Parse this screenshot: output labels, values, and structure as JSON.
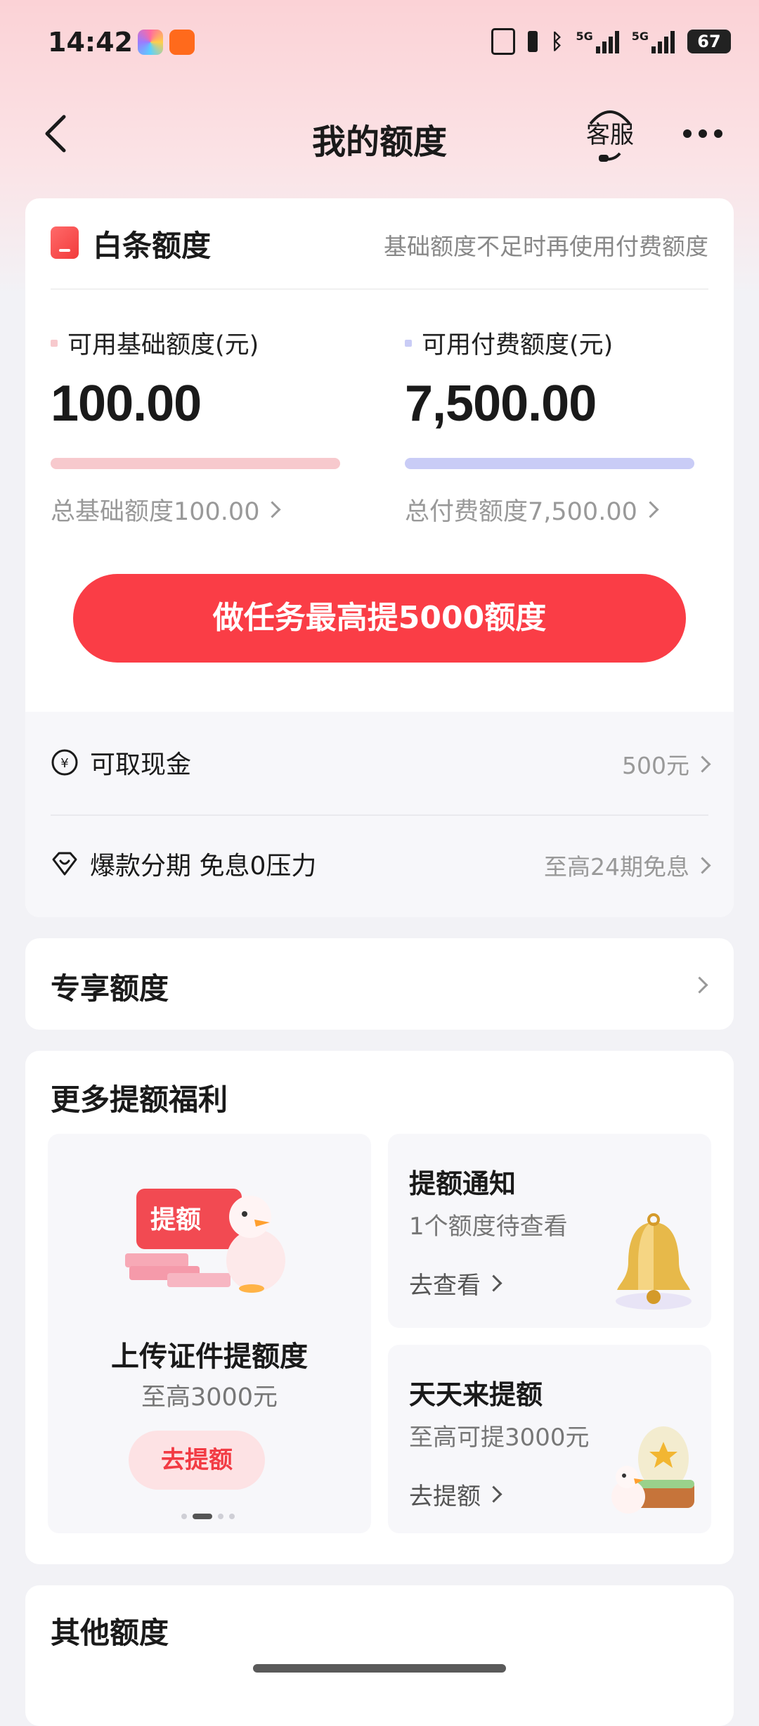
{
  "status_bar": {
    "time": "14:42",
    "net1": "5G",
    "net2": "5G",
    "battery": "67"
  },
  "nav": {
    "title": "我的额度",
    "customer_service": "客服"
  },
  "main_card": {
    "title": "白条额度",
    "hint": "基础额度不足时再使用付费额度",
    "basic": {
      "label": "可用基础额度(元)",
      "value": "100.00",
      "total": "总基础额度100.00",
      "color": "#f7c9cd"
    },
    "paid": {
      "label": "可用付费额度(元)",
      "value": "7,500.00",
      "total": "总付费额度7,500.00",
      "color": "#c9ccf6"
    },
    "cta": "做任务最高提5000额度",
    "rows": [
      {
        "icon": "yen-circle-icon",
        "label": "可取现金",
        "right": "500元"
      },
      {
        "icon": "diamond-heart-icon",
        "label": "爆款分期 免息0压力",
        "right": "至高24期免息"
      }
    ]
  },
  "exclusive": {
    "label": "专享额度"
  },
  "more_benefits": {
    "title": "更多提额福利",
    "big_tile": {
      "badge": "提额",
      "title": "上传证件提额度",
      "sub": "至高3000元",
      "button": "去提额"
    },
    "tile1": {
      "title": "提额通知",
      "sub": "1个额度待查看",
      "link": "去查看"
    },
    "tile2": {
      "title": "天天来提额",
      "sub": "至高可提3000元",
      "link": "去提额"
    }
  },
  "other": {
    "title": "其他额度"
  },
  "colors": {
    "accent": "#fa3d46",
    "accent_soft": "#fde2e4"
  }
}
